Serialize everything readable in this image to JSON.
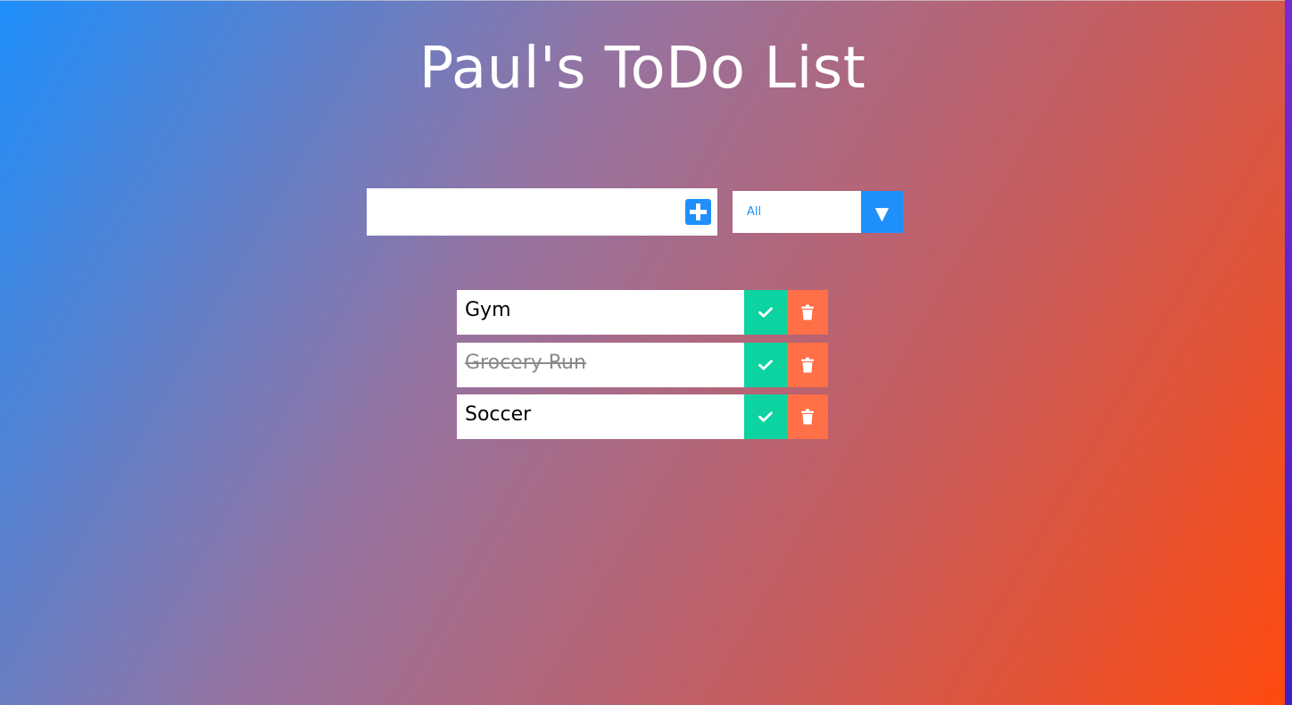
{
  "header": {
    "title": "Paul's ToDo List"
  },
  "form": {
    "input_value": "",
    "add_icon": "plus-square-icon",
    "filter": {
      "selected": "All",
      "arrow_icon": "caret-down-icon",
      "arrow_glyph": "▼"
    }
  },
  "todos": [
    {
      "text": "Gym",
      "completed": false
    },
    {
      "text": "Grocery Run",
      "completed": true
    },
    {
      "text": "Soccer",
      "completed": false
    }
  ],
  "icons": {
    "complete": "check-icon",
    "delete": "trash-icon"
  },
  "colors": {
    "accent_blue": "#1f8ffb",
    "complete_green": "#0dd3a1",
    "delete_orange": "#ff6f48",
    "gradient_start": "#1f8ffb",
    "gradient_end": "#ff4a0d"
  }
}
